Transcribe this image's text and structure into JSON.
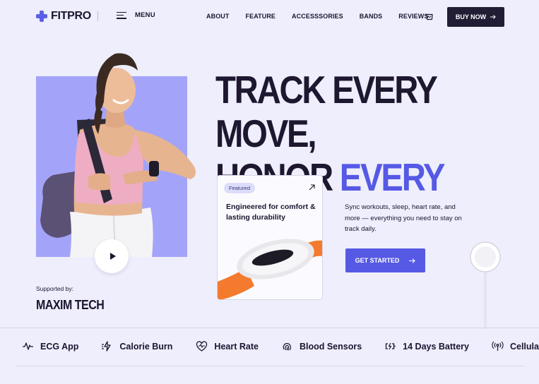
{
  "brand": {
    "name": "FITPRO",
    "accent_color": "#5659e4"
  },
  "nav": {
    "menu_label": "MENU",
    "links": [
      "ABOUT",
      "FEATURE",
      "ACCESSSORIES",
      "BANDS",
      "REVIEWS"
    ],
    "cart_icon": "shopping-bag-icon",
    "buy_button": "BUY NOW"
  },
  "hero": {
    "headline_line1": "TRACK EVERY MOVE,",
    "headline_line2_plain": "HONOR",
    "headline_line2_accent": "EVERY BEAT",
    "description": "Sync workouts, sleep, heart rate, and more — everything you need to stay on track daily.",
    "cta_label": "GET STARTED",
    "play_icon": "play-icon"
  },
  "featured_card": {
    "badge": "Featured",
    "title": "Engineered for comfort & lasting durability"
  },
  "supported": {
    "label": "Supported by:",
    "brand": "MAXIM TECH"
  },
  "features": [
    {
      "label": "ECG App",
      "icon": "ecg-pulse-icon"
    },
    {
      "label": "Calorie Burn",
      "icon": "calorie-burn-icon"
    },
    {
      "label": "Heart Rate",
      "icon": "heart-rate-icon"
    },
    {
      "label": "Blood Sensors",
      "icon": "fingerprint-sensor-icon"
    },
    {
      "label": "14 Days Battery",
      "icon": "battery-charging-icon"
    },
    {
      "label": "Cellular",
      "icon": "cellular-signal-icon"
    }
  ]
}
